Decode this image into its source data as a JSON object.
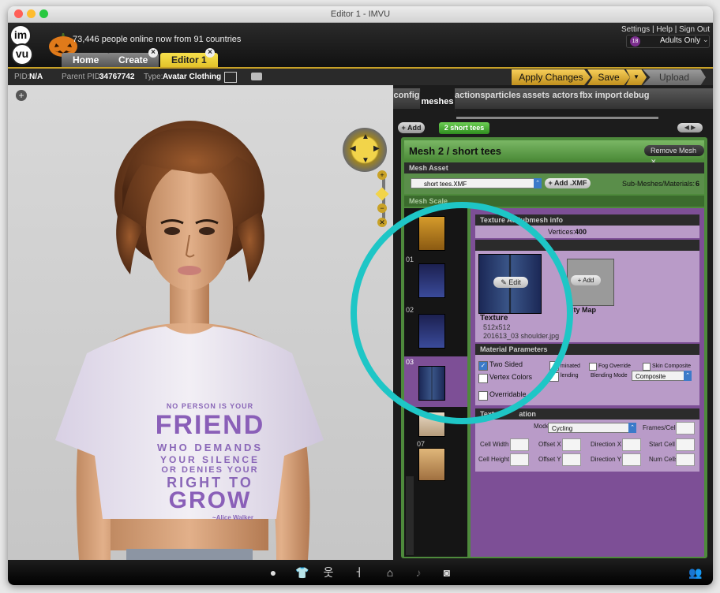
{
  "window": {
    "title": "Editor 1 - IMVU"
  },
  "header": {
    "logo_text": "imvu",
    "online_text": "73,446 people online now from 91 countries",
    "links": {
      "settings": "Settings",
      "help": "Help",
      "signout": "Sign Out",
      "sep": "|"
    },
    "adults_badge": "18",
    "adults_label": "Adults Only",
    "tabs": {
      "home": "Home",
      "create": "Create",
      "editor": "Editor 1"
    }
  },
  "infobar": {
    "pid_label": "PID:",
    "pid_value": "N/A",
    "parent_label": "Parent PID:",
    "parent_value": "34767742",
    "type_label": "Type:",
    "type_value": "Avatar Clothing"
  },
  "actions": {
    "apply": "Apply Changes",
    "save": "Save",
    "dropdown": "▼",
    "upload": "Upload"
  },
  "panel": {
    "tabs": [
      "config",
      "meshes",
      "actions",
      "particles",
      "assets",
      "actors",
      "fbx import",
      "debug"
    ],
    "add_label": "+ Add",
    "mesh_chip": "2 short tees",
    "mesh_title": "Mesh 2 / short tees",
    "remove_mesh": "Remove Mesh",
    "mesh_asset_header": "Mesh Asset",
    "file_select": "short tees.XMF",
    "add_xmf": "+ Add .XMF",
    "submesh_label": "Sub-Meshes/Materials:",
    "submesh_count": "6",
    "mesh_scale_header": "Mesh Scale",
    "thumb_numbers": [
      "01",
      "02",
      "03",
      "07"
    ],
    "texture_header": "Texture As",
    "submesh_info": "Submesh info",
    "vertices_label": "Vertices:",
    "vertices_value": "400",
    "edit_label": "Edit",
    "add_small": "Add",
    "texture_label": "Texture",
    "texture_size": "512x512",
    "texture_file": "201613_03 shoulder.jpg",
    "opacity_map": "ity Map",
    "material_header": "Material Parameters",
    "two_sided": "Two Sided",
    "vertex_colors": "Vertex Colors",
    "overridable": "Overridable",
    "illuminated": "minated",
    "blending": "lending",
    "fog_override": "Fog Override",
    "skin_composite": "Skin Composite",
    "blending_mode_label": "Blending Mode",
    "blending_mode_value": "Composite",
    "texture_anim_header": "Textur",
    "animation_word": "ation",
    "mode_label": "Mode",
    "mode_value": "Cycling",
    "frames_cell": "Frames/Cell",
    "cell_width": "Cell Width",
    "offset_x": "Offset X",
    "direction_x": "Direction X",
    "start_cell": "Start Cell",
    "cell_height": "Cell Height",
    "offset_y": "Offset Y",
    "direction_y": "Direction Y",
    "num_cells": "Num Cells"
  },
  "shirt": {
    "line1": "NO PERSON IS YOUR",
    "line2": "FRIEND",
    "line3": "WHO DEMANDS",
    "line4": "YOUR SILENCE",
    "line5": "OR DENIES YOUR",
    "line6": "RIGHT TO",
    "line7": "GROW",
    "line8": "~Alice Walker"
  },
  "colors": {
    "accent_gold": "#c9a227",
    "panel_purple": "#7d4f96",
    "highlight_teal": "#1ec6c6",
    "green_header": "#4e8a3c"
  }
}
